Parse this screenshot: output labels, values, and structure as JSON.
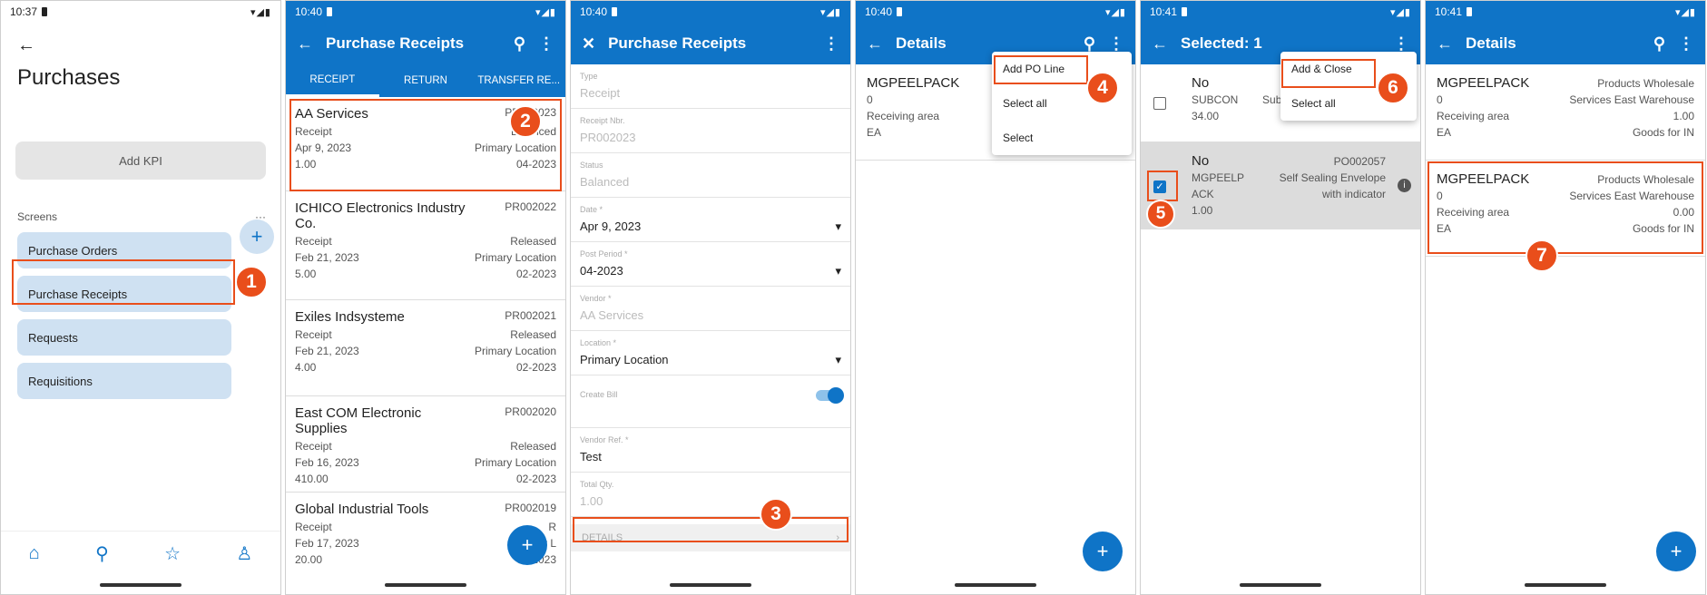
{
  "screen1": {
    "time": "10:37",
    "title": "Purchases",
    "add_kpi": "Add KPI",
    "screens_label": "Screens",
    "more": "···",
    "items": [
      "Purchase Orders",
      "Purchase Receipts",
      "Requests",
      "Requisitions"
    ],
    "badge": "1"
  },
  "screen2": {
    "time": "10:40",
    "title": "Purchase Receipts",
    "tabs": [
      "RECEIPT",
      "RETURN",
      "TRANSFER RE..."
    ],
    "badge": "2",
    "rows": [
      {
        "name": "AA Services",
        "nbr": "PR002023",
        "type": "Receipt",
        "status": "Balanced",
        "date": "Apr 9, 2023",
        "loc": "Primary Location",
        "qty": "1.00",
        "period": "04-2023"
      },
      {
        "name": "ICHICO Electronics Industry Co.",
        "nbr": "PR002022",
        "type": "Receipt",
        "status": "Released",
        "date": "Feb 21, 2023",
        "loc": "Primary Location",
        "qty": "5.00",
        "period": "02-2023"
      },
      {
        "name": "Exiles Indsysteme",
        "nbr": "PR002021",
        "type": "Receipt",
        "status": "Released",
        "date": "Feb 21, 2023",
        "loc": "Primary Location",
        "qty": "4.00",
        "period": "02-2023"
      },
      {
        "name": "East COM Electronic Supplies",
        "nbr": "PR002020",
        "type": "Receipt",
        "status": "Released",
        "date": "Feb 16, 2023",
        "loc": "Primary Location",
        "qty": "410.00",
        "period": "02-2023"
      },
      {
        "name": "Global Industrial Tools",
        "nbr": "PR002019",
        "type": "Receipt",
        "status": "R",
        "date": "Feb 17, 2023",
        "loc": "Primary L",
        "qty": "20.00",
        "period": "02-2023"
      }
    ]
  },
  "screen3": {
    "time": "10:40",
    "title": "Purchase Receipts",
    "badge": "3",
    "details": "DETAILS",
    "fields": [
      {
        "label": "Type",
        "value": "Receipt"
      },
      {
        "label": "Receipt Nbr.",
        "value": "PR002023"
      },
      {
        "label": "Status",
        "value": "Balanced"
      },
      {
        "label": "Date *",
        "value": "Apr 9, 2023"
      },
      {
        "label": "Post Period *",
        "value": "04-2023"
      },
      {
        "label": "Vendor *",
        "value": "AA Services"
      },
      {
        "label": "Location *",
        "value": "Primary Location"
      },
      {
        "label": "Create Bill",
        "value": ""
      },
      {
        "label": "Vendor Ref. *",
        "value": "Test"
      },
      {
        "label": "Total Qty.",
        "value": "1.00"
      }
    ]
  },
  "screen4": {
    "time": "10:40",
    "title": "Details",
    "badge": "4",
    "item": {
      "name": "MGPEELPACK",
      "qty": "0",
      "area": "Receiving area",
      "uom": "EA"
    },
    "menu": [
      "Add PO Line",
      "Select all",
      "Select"
    ]
  },
  "screen5": {
    "time": "10:41",
    "title": "Selected: 1",
    "badge5": "5",
    "badge6": "6",
    "row1": {
      "title": "No",
      "l1": "SUBCON",
      "l1r": "Sub",
      "l2": "34.00"
    },
    "row2": {
      "title": "No",
      "nbr": "PO002057",
      "l1": "MGPEELP",
      "l1b": "ACK",
      "desc1": "Self Sealing Envelope",
      "desc2": "with indicator",
      "qty": "1.00"
    },
    "menu": [
      "Add & Close",
      "Select all"
    ]
  },
  "screen6": {
    "time": "10:41",
    "title": "Details",
    "badge": "7",
    "items": [
      {
        "name": "MGPEELPACK",
        "vendor": "Products Wholesale",
        "qty": "0",
        "wh": "Services East Warehouse",
        "area": "Receiving area",
        "val": "1.00",
        "uom": "EA",
        "desc": "Goods for IN"
      },
      {
        "name": "MGPEELPACK",
        "vendor": "Products Wholesale",
        "qty": "0",
        "wh": "Services East Warehouse",
        "area": "Receiving area",
        "val": "0.00",
        "uom": "EA",
        "desc": "Goods for IN"
      }
    ]
  }
}
